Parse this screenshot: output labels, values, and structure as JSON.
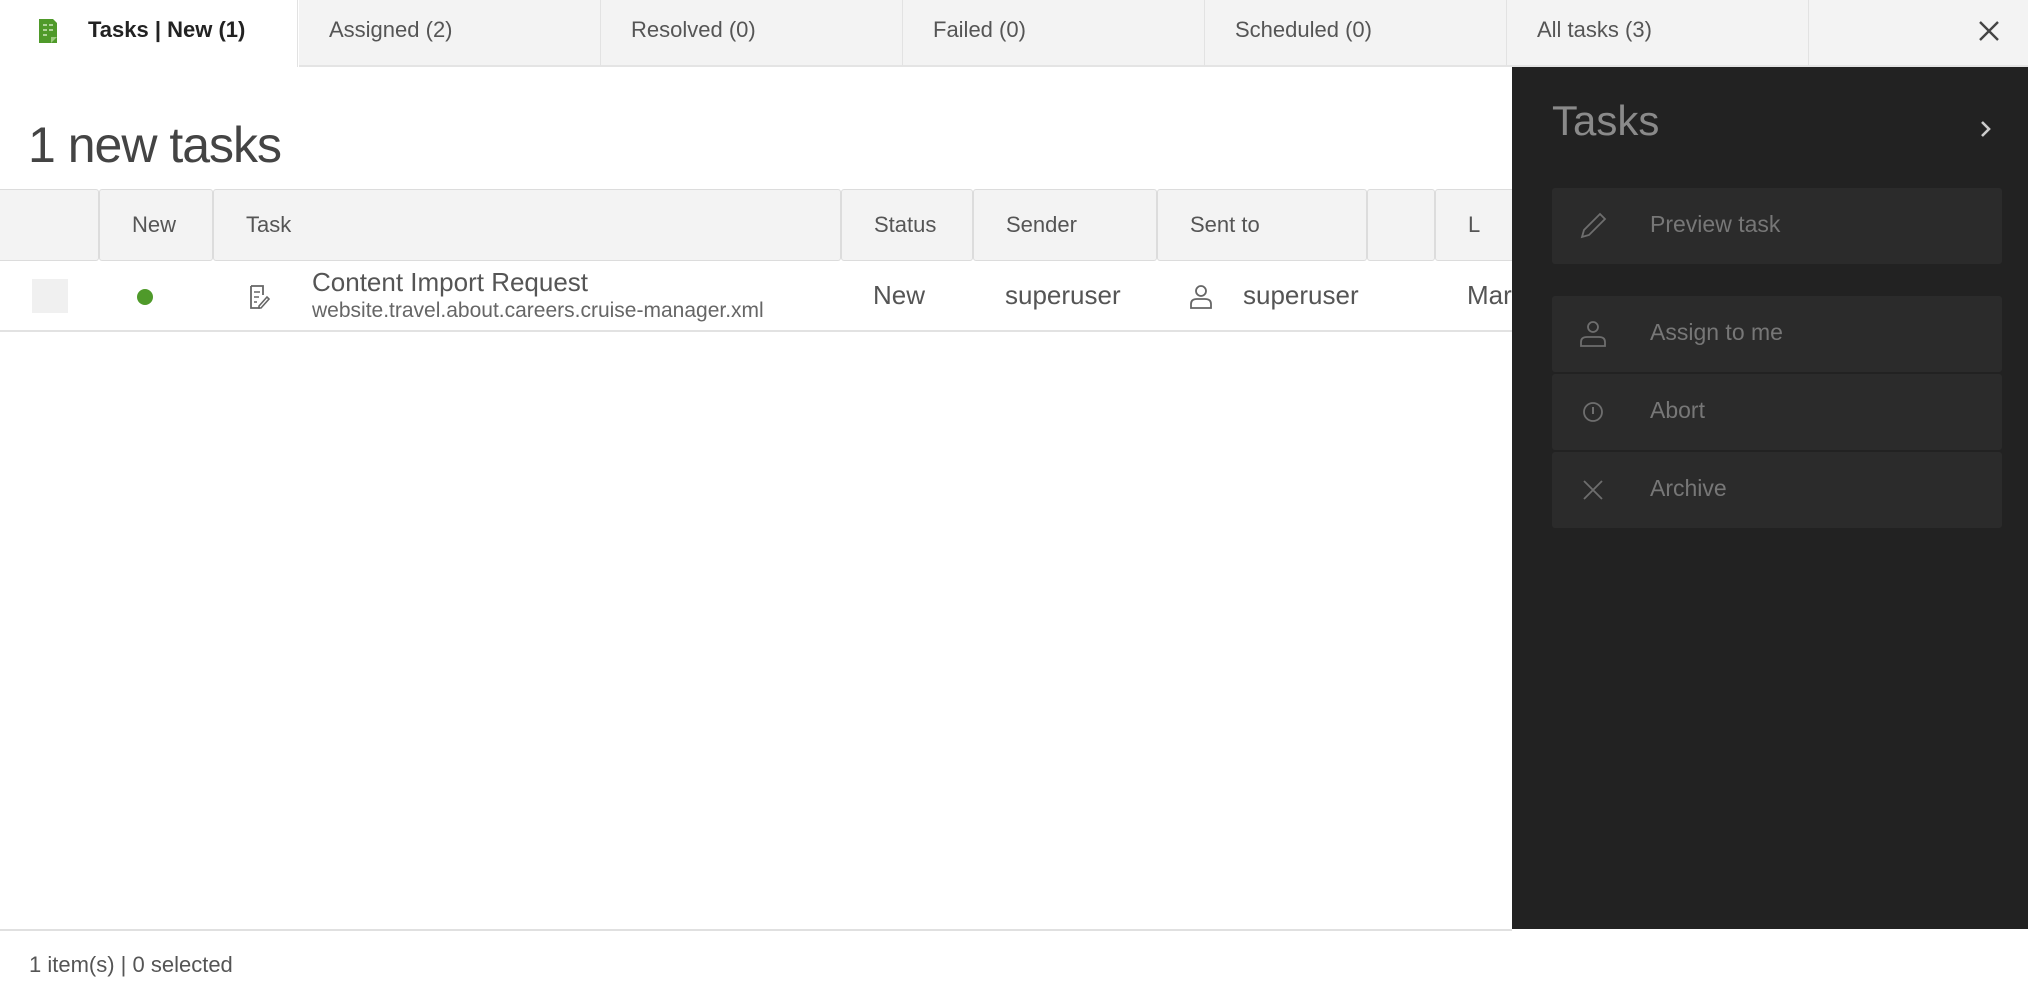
{
  "tabs": [
    {
      "label": "Tasks | New (1)",
      "active": true
    },
    {
      "label": "Assigned (2)"
    },
    {
      "label": "Resolved (0)"
    },
    {
      "label": "Failed (0)"
    },
    {
      "label": "Scheduled (0)"
    },
    {
      "label": "All tasks (3)"
    }
  ],
  "accent_color": "#4f9a2a",
  "heading": "1 new tasks",
  "table": {
    "columns": [
      "",
      "New",
      "Task",
      "Status",
      "Sender",
      "Sent to",
      "",
      "L"
    ],
    "rows": [
      {
        "task_title": "Content Import Request",
        "task_path": "website.travel.about.careers.cruise-manager.xml",
        "status": "New",
        "sender": "superuser",
        "sent_to": "superuser",
        "last_col": "Mar"
      }
    ]
  },
  "panel": {
    "title": "Tasks",
    "actions": [
      {
        "label": "Preview task",
        "icon": "pencil-icon"
      },
      {
        "label": "Assign to me",
        "icon": "user-icon"
      },
      {
        "label": "Abort",
        "icon": "info-circle-icon"
      },
      {
        "label": "Archive",
        "icon": "close-icon"
      }
    ]
  },
  "footer": "1 item(s) | 0 selected"
}
